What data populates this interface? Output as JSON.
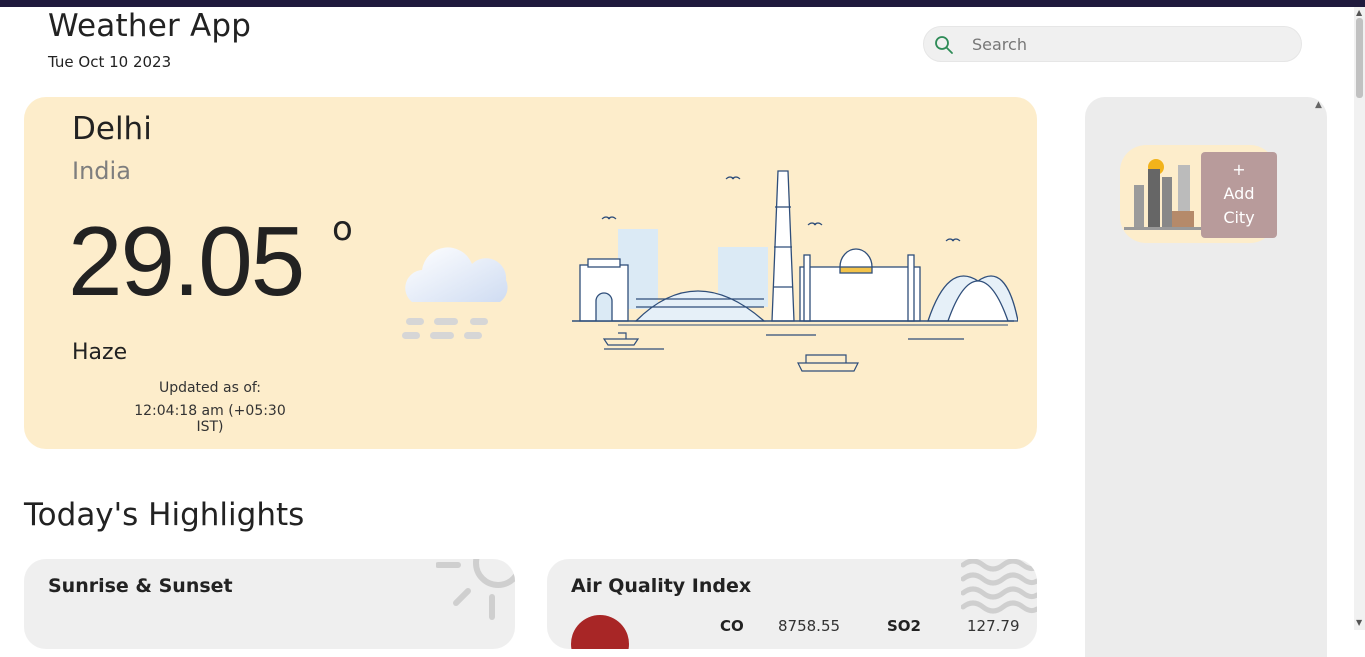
{
  "header": {
    "title": "Weather App",
    "date": "Tue Oct 10 2023"
  },
  "search": {
    "placeholder": "Search",
    "icon": "search-icon"
  },
  "current": {
    "city": "Delhi",
    "country": "India",
    "temperature": "29.05",
    "degree_symbol": "o",
    "condition": "Haze",
    "updated_label": "Updated as of:",
    "updated_time": "12:04:18 am (+05:30 IST)",
    "weather_icon": "haze-cloud-icon"
  },
  "sidebar": {
    "add_city_plus": "+",
    "add_city_line1": "Add",
    "add_city_line2": "City"
  },
  "highlights": {
    "title": "Today's Highlights",
    "sunrise_sunset": {
      "title": "Sunrise & Sunset",
      "icon": "sun-icon"
    },
    "air_quality": {
      "title": "Air Quality Index",
      "icon": "wind-icon",
      "items": [
        {
          "label": "CO",
          "value": "8758.55"
        },
        {
          "label": "SO2",
          "value": "127.79"
        }
      ]
    }
  },
  "colors": {
    "hero_bg": "#fdedcb",
    "sidebar_bg": "#ececec",
    "add_city_bg": "#b89b9b",
    "card_bg": "#efefef",
    "aqi_indicator": "#a82626",
    "search_icon": "#2e8b57"
  }
}
